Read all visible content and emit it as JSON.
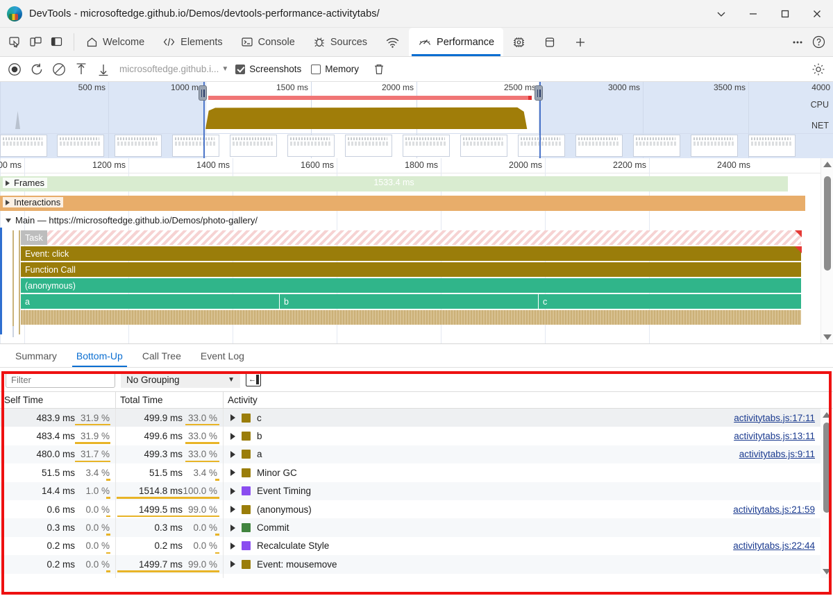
{
  "window": {
    "title": "DevTools - microsoftedge.github.io/Demos/devtools-performance-activitytabs/",
    "controls": {
      "more": "chevron-down",
      "minimize": "minimize",
      "maximize": "maximize",
      "close": "close"
    }
  },
  "tabstrip": {
    "left_icons": [
      "inspect-element-icon",
      "device-toolbar-icon",
      "dock-side-icon"
    ],
    "tabs": [
      {
        "label": "Welcome",
        "icon": "home-icon",
        "active": false
      },
      {
        "label": "Elements",
        "icon": "code-icon",
        "active": false
      },
      {
        "label": "Console",
        "icon": "console-icon",
        "active": false
      },
      {
        "label": "Sources",
        "icon": "bug-icon",
        "active": false
      },
      {
        "label": "",
        "icon": "network-icon",
        "active": false
      },
      {
        "label": "Performance",
        "icon": "performance-icon",
        "active": true
      },
      {
        "label": "",
        "icon": "memory-chip-icon",
        "active": false
      },
      {
        "label": "",
        "icon": "application-icon",
        "active": false
      },
      {
        "label": "",
        "icon": "plus-icon",
        "active": false
      }
    ],
    "right_icons": [
      "more-options-icon",
      "help-icon"
    ]
  },
  "perf_toolbar": {
    "record_label": "record-icon",
    "reload_label": "reload-record-icon",
    "clear_label": "clear-icon",
    "upload_label": "upload-profile-icon",
    "download_label": "download-profile-icon",
    "url": "microsoftedge.github.i...",
    "screenshots": {
      "label": "Screenshots",
      "checked": true
    },
    "memory": {
      "label": "Memory",
      "checked": false
    },
    "trash_label": "delete-icon",
    "settings_label": "settings-gear-icon"
  },
  "overview": {
    "ticks": [
      "500 ms",
      "1000 ms",
      "1500 ms",
      "2000 ms",
      "2500 ms",
      "3000 ms",
      "3500 ms",
      "4000"
    ],
    "cpu_label": "CPU",
    "net_label": "NET",
    "selection_start_label": "1000 ms",
    "selection_end_label": "2500 ms"
  },
  "flame": {
    "ruler_ticks": [
      "00 ms",
      "1200 ms",
      "1400 ms",
      "1600 ms",
      "1800 ms",
      "2000 ms",
      "2200 ms",
      "2400 ms"
    ],
    "groups": [
      {
        "name": "Frames",
        "expanded": false,
        "frame_label": "1533.4 ms"
      },
      {
        "name": "Interactions",
        "expanded": false
      },
      {
        "name": "Main — https://microsoftedge.github.io/Demos/photo-gallery/",
        "expanded": true
      }
    ],
    "bars": [
      {
        "label": "Task",
        "kind": "task"
      },
      {
        "label": "Event: click",
        "kind": "olive"
      },
      {
        "label": "Function Call",
        "kind": "olive"
      },
      {
        "label": "(anonymous)",
        "kind": "green"
      },
      {
        "label": "a",
        "kind": "green"
      },
      {
        "label": "b",
        "kind": "green"
      },
      {
        "label": "c",
        "kind": "green"
      }
    ]
  },
  "bottom_tabs": [
    {
      "label": "Summary",
      "active": false
    },
    {
      "label": "Bottom-Up",
      "active": true
    },
    {
      "label": "Call Tree",
      "active": false
    },
    {
      "label": "Event Log",
      "active": false
    }
  ],
  "grid_toolbar": {
    "filter_placeholder": "Filter",
    "filter_value": "",
    "grouping_value": "No Grouping",
    "match_case_label": "collapse-sidebar-icon"
  },
  "grid": {
    "columns": [
      "Self Time",
      "Total Time",
      "Activity"
    ],
    "rows": [
      {
        "self_ms": "483.9 ms",
        "self_pct": "31.9 %",
        "self_bar": 0.319,
        "total_ms": "499.9 ms",
        "total_pct": "33.0 %",
        "total_bar": 0.33,
        "activity": "c",
        "color": "#9a7d0a",
        "link": "activitytabs.js:17:11"
      },
      {
        "self_ms": "483.4 ms",
        "self_pct": "31.9 %",
        "self_bar": 0.319,
        "total_ms": "499.6 ms",
        "total_pct": "33.0 %",
        "total_bar": 0.33,
        "activity": "b",
        "color": "#9a7d0a",
        "link": "activitytabs.js:13:11"
      },
      {
        "self_ms": "480.0 ms",
        "self_pct": "31.7 %",
        "self_bar": 0.317,
        "total_ms": "499.3 ms",
        "total_pct": "33.0 %",
        "total_bar": 0.33,
        "activity": "a",
        "color": "#9a7d0a",
        "link": "activitytabs.js:9:11"
      },
      {
        "self_ms": "51.5 ms",
        "self_pct": "3.4 %",
        "self_bar": 0.034,
        "total_ms": "51.5 ms",
        "total_pct": "3.4 %",
        "total_bar": 0.034,
        "activity": "Minor GC",
        "color": "#9a7d0a",
        "link": ""
      },
      {
        "self_ms": "14.4 ms",
        "self_pct": "1.0 %",
        "self_bar": 0.01,
        "total_ms": "1514.8 ms",
        "total_pct": "100.0 %",
        "total_bar": 1.0,
        "activity": "Event Timing",
        "color": "#8a4df0",
        "link": ""
      },
      {
        "self_ms": "0.6 ms",
        "self_pct": "0.0 %",
        "self_bar": 0.004,
        "total_ms": "1499.5 ms",
        "total_pct": "99.0 %",
        "total_bar": 0.99,
        "activity": "(anonymous)",
        "color": "#9a7d0a",
        "link": "activitytabs.js:21:59"
      },
      {
        "self_ms": "0.3 ms",
        "self_pct": "0.0 %",
        "self_bar": 0.002,
        "total_ms": "0.3 ms",
        "total_pct": "0.0 %",
        "total_bar": 0.002,
        "activity": "Commit",
        "color": "#41843f",
        "link": ""
      },
      {
        "self_ms": "0.2 ms",
        "self_pct": "0.0 %",
        "self_bar": 0.002,
        "total_ms": "0.2 ms",
        "total_pct": "0.0 %",
        "total_bar": 0.002,
        "activity": "Recalculate Style",
        "color": "#8a4df0",
        "link": "activitytabs.js:22:44"
      },
      {
        "self_ms": "0.2 ms",
        "self_pct": "0.0 %",
        "self_bar": 0.002,
        "total_ms": "1499.7 ms",
        "total_pct": "99.0 %",
        "total_bar": 0.99,
        "activity": "Event: mousemove",
        "color": "#9a7d0a",
        "link": ""
      }
    ]
  },
  "colors": {
    "accent": "#0a6ed1",
    "highlight_box": "#ee1111",
    "bar_underline": "#e8b427",
    "frames_track": "#d9ecd0",
    "interactions_track": "#e8ad6a"
  }
}
